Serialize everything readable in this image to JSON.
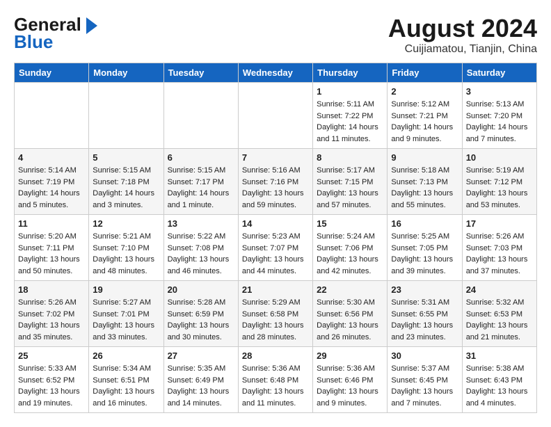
{
  "header": {
    "logo_general": "General",
    "logo_blue": "Blue",
    "month": "August 2024",
    "location": "Cuijiamatou, Tianjin, China"
  },
  "weekdays": [
    "Sunday",
    "Monday",
    "Tuesday",
    "Wednesday",
    "Thursday",
    "Friday",
    "Saturday"
  ],
  "weeks": [
    [
      {
        "day": "",
        "sunrise": "",
        "sunset": "",
        "daylight": ""
      },
      {
        "day": "",
        "sunrise": "",
        "sunset": "",
        "daylight": ""
      },
      {
        "day": "",
        "sunrise": "",
        "sunset": "",
        "daylight": ""
      },
      {
        "day": "",
        "sunrise": "",
        "sunset": "",
        "daylight": ""
      },
      {
        "day": "1",
        "sunrise": "Sunrise: 5:11 AM",
        "sunset": "Sunset: 7:22 PM",
        "daylight": "Daylight: 14 hours and 11 minutes."
      },
      {
        "day": "2",
        "sunrise": "Sunrise: 5:12 AM",
        "sunset": "Sunset: 7:21 PM",
        "daylight": "Daylight: 14 hours and 9 minutes."
      },
      {
        "day": "3",
        "sunrise": "Sunrise: 5:13 AM",
        "sunset": "Sunset: 7:20 PM",
        "daylight": "Daylight: 14 hours and 7 minutes."
      }
    ],
    [
      {
        "day": "4",
        "sunrise": "Sunrise: 5:14 AM",
        "sunset": "Sunset: 7:19 PM",
        "daylight": "Daylight: 14 hours and 5 minutes."
      },
      {
        "day": "5",
        "sunrise": "Sunrise: 5:15 AM",
        "sunset": "Sunset: 7:18 PM",
        "daylight": "Daylight: 14 hours and 3 minutes."
      },
      {
        "day": "6",
        "sunrise": "Sunrise: 5:15 AM",
        "sunset": "Sunset: 7:17 PM",
        "daylight": "Daylight: 14 hours and 1 minute."
      },
      {
        "day": "7",
        "sunrise": "Sunrise: 5:16 AM",
        "sunset": "Sunset: 7:16 PM",
        "daylight": "Daylight: 13 hours and 59 minutes."
      },
      {
        "day": "8",
        "sunrise": "Sunrise: 5:17 AM",
        "sunset": "Sunset: 7:15 PM",
        "daylight": "Daylight: 13 hours and 57 minutes."
      },
      {
        "day": "9",
        "sunrise": "Sunrise: 5:18 AM",
        "sunset": "Sunset: 7:13 PM",
        "daylight": "Daylight: 13 hours and 55 minutes."
      },
      {
        "day": "10",
        "sunrise": "Sunrise: 5:19 AM",
        "sunset": "Sunset: 7:12 PM",
        "daylight": "Daylight: 13 hours and 53 minutes."
      }
    ],
    [
      {
        "day": "11",
        "sunrise": "Sunrise: 5:20 AM",
        "sunset": "Sunset: 7:11 PM",
        "daylight": "Daylight: 13 hours and 50 minutes."
      },
      {
        "day": "12",
        "sunrise": "Sunrise: 5:21 AM",
        "sunset": "Sunset: 7:10 PM",
        "daylight": "Daylight: 13 hours and 48 minutes."
      },
      {
        "day": "13",
        "sunrise": "Sunrise: 5:22 AM",
        "sunset": "Sunset: 7:08 PM",
        "daylight": "Daylight: 13 hours and 46 minutes."
      },
      {
        "day": "14",
        "sunrise": "Sunrise: 5:23 AM",
        "sunset": "Sunset: 7:07 PM",
        "daylight": "Daylight: 13 hours and 44 minutes."
      },
      {
        "day": "15",
        "sunrise": "Sunrise: 5:24 AM",
        "sunset": "Sunset: 7:06 PM",
        "daylight": "Daylight: 13 hours and 42 minutes."
      },
      {
        "day": "16",
        "sunrise": "Sunrise: 5:25 AM",
        "sunset": "Sunset: 7:05 PM",
        "daylight": "Daylight: 13 hours and 39 minutes."
      },
      {
        "day": "17",
        "sunrise": "Sunrise: 5:26 AM",
        "sunset": "Sunset: 7:03 PM",
        "daylight": "Daylight: 13 hours and 37 minutes."
      }
    ],
    [
      {
        "day": "18",
        "sunrise": "Sunrise: 5:26 AM",
        "sunset": "Sunset: 7:02 PM",
        "daylight": "Daylight: 13 hours and 35 minutes."
      },
      {
        "day": "19",
        "sunrise": "Sunrise: 5:27 AM",
        "sunset": "Sunset: 7:01 PM",
        "daylight": "Daylight: 13 hours and 33 minutes."
      },
      {
        "day": "20",
        "sunrise": "Sunrise: 5:28 AM",
        "sunset": "Sunset: 6:59 PM",
        "daylight": "Daylight: 13 hours and 30 minutes."
      },
      {
        "day": "21",
        "sunrise": "Sunrise: 5:29 AM",
        "sunset": "Sunset: 6:58 PM",
        "daylight": "Daylight: 13 hours and 28 minutes."
      },
      {
        "day": "22",
        "sunrise": "Sunrise: 5:30 AM",
        "sunset": "Sunset: 6:56 PM",
        "daylight": "Daylight: 13 hours and 26 minutes."
      },
      {
        "day": "23",
        "sunrise": "Sunrise: 5:31 AM",
        "sunset": "Sunset: 6:55 PM",
        "daylight": "Daylight: 13 hours and 23 minutes."
      },
      {
        "day": "24",
        "sunrise": "Sunrise: 5:32 AM",
        "sunset": "Sunset: 6:53 PM",
        "daylight": "Daylight: 13 hours and 21 minutes."
      }
    ],
    [
      {
        "day": "25",
        "sunrise": "Sunrise: 5:33 AM",
        "sunset": "Sunset: 6:52 PM",
        "daylight": "Daylight: 13 hours and 19 minutes."
      },
      {
        "day": "26",
        "sunrise": "Sunrise: 5:34 AM",
        "sunset": "Sunset: 6:51 PM",
        "daylight": "Daylight: 13 hours and 16 minutes."
      },
      {
        "day": "27",
        "sunrise": "Sunrise: 5:35 AM",
        "sunset": "Sunset: 6:49 PM",
        "daylight": "Daylight: 13 hours and 14 minutes."
      },
      {
        "day": "28",
        "sunrise": "Sunrise: 5:36 AM",
        "sunset": "Sunset: 6:48 PM",
        "daylight": "Daylight: 13 hours and 11 minutes."
      },
      {
        "day": "29",
        "sunrise": "Sunrise: 5:36 AM",
        "sunset": "Sunset: 6:46 PM",
        "daylight": "Daylight: 13 hours and 9 minutes."
      },
      {
        "day": "30",
        "sunrise": "Sunrise: 5:37 AM",
        "sunset": "Sunset: 6:45 PM",
        "daylight": "Daylight: 13 hours and 7 minutes."
      },
      {
        "day": "31",
        "sunrise": "Sunrise: 5:38 AM",
        "sunset": "Sunset: 6:43 PM",
        "daylight": "Daylight: 13 hours and 4 minutes."
      }
    ]
  ]
}
